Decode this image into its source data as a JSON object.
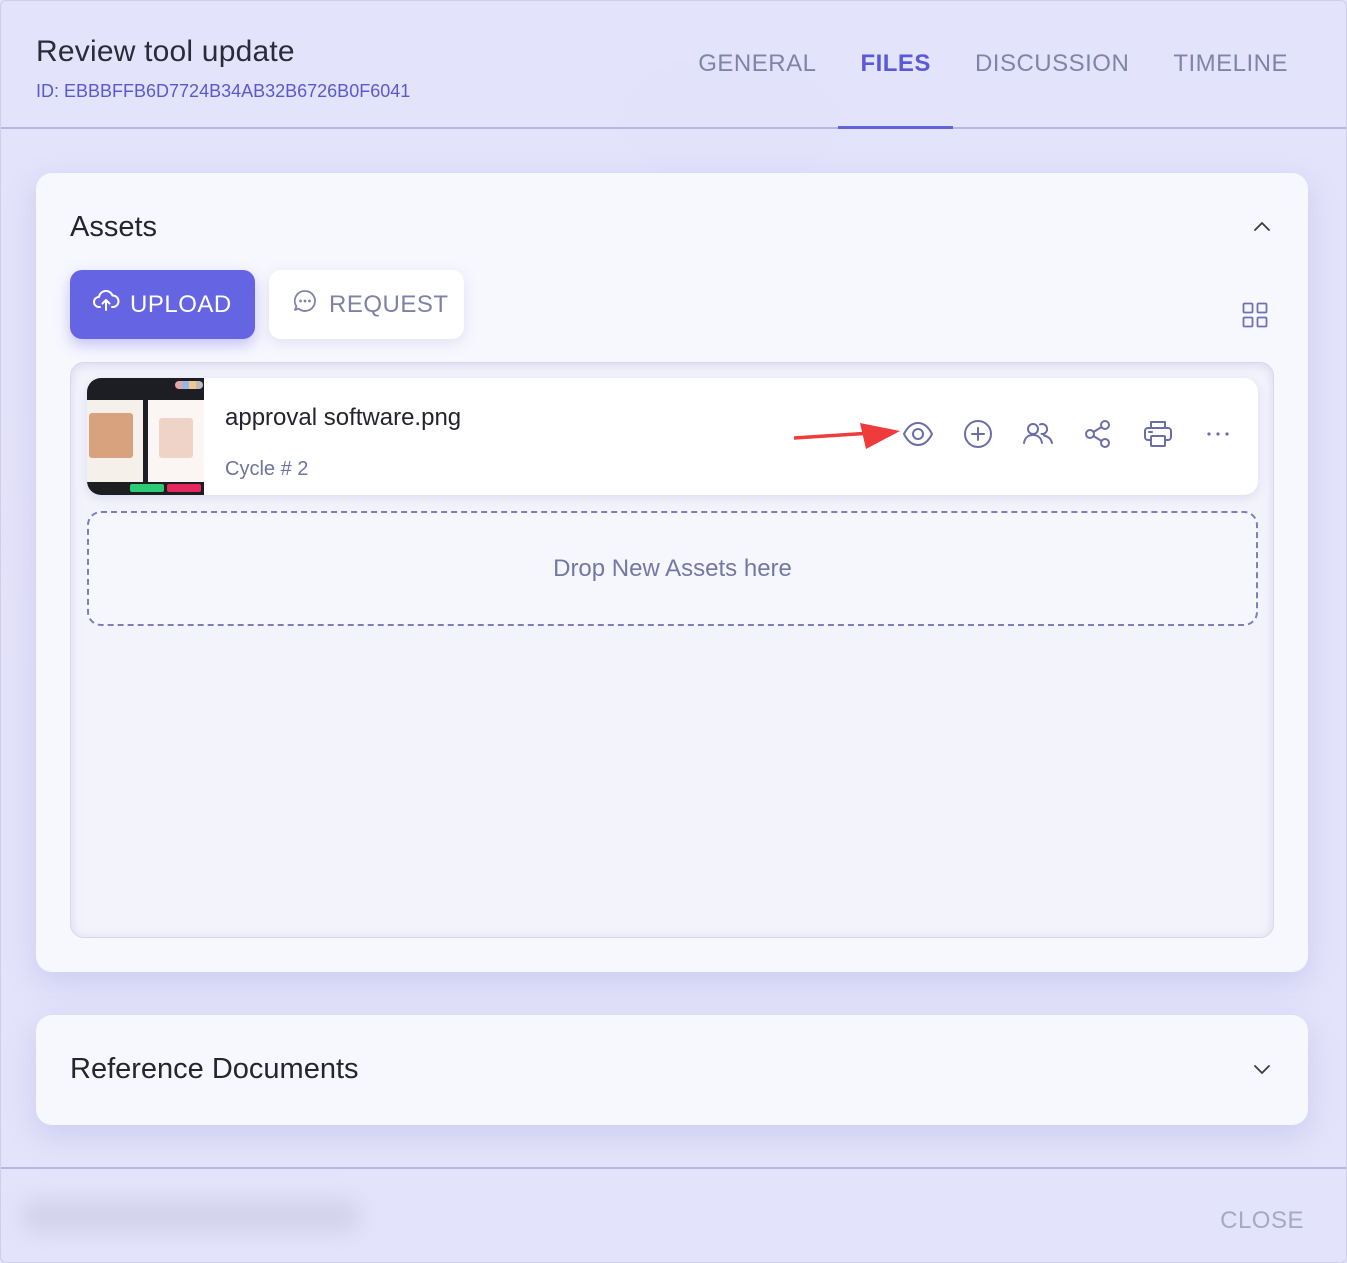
{
  "header": {
    "title": "Review tool update",
    "id_label": "ID: EBBBFFB6D7724B34AB32B6726B0F6041"
  },
  "tabs": [
    {
      "label": "GENERAL",
      "active": false
    },
    {
      "label": "FILES",
      "active": true
    },
    {
      "label": "DISCUSSION",
      "active": false
    },
    {
      "label": "TIMELINE",
      "active": false
    }
  ],
  "assets": {
    "title": "Assets",
    "upload_label": "UPLOAD",
    "request_label": "REQUEST",
    "file": {
      "name": "approval software.png",
      "cycle": "Cycle # 2",
      "actions": [
        "eye-icon",
        "plus-circle-icon",
        "users-icon",
        "share-icon",
        "printer-icon",
        "more-icon"
      ]
    },
    "dropzone_label": "Drop New Assets here"
  },
  "reference": {
    "title": "Reference Documents"
  },
  "footer": {
    "close_label": "CLOSE"
  },
  "colors": {
    "accent": "#6565e4",
    "annotation_arrow": "#ef3b3b"
  }
}
